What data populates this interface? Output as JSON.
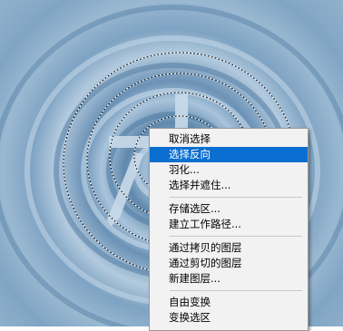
{
  "colors": {
    "canvas_bg": "#7fa3c1",
    "ripple_light": "#b8cfe2",
    "ripple_dark": "#4f7ea6",
    "menu_bg": "#f2f2f2",
    "highlight": "#0a6fd0"
  },
  "canvas": {
    "glyph": "大",
    "selection": "marching-ants"
  },
  "context_menu": {
    "groups": [
      [
        {
          "label": "取消选择"
        },
        {
          "label": "选择反向",
          "highlighted": true
        },
        {
          "label": "羽化..."
        },
        {
          "label": "选择并遮住..."
        }
      ],
      [
        {
          "label": "存储选区..."
        },
        {
          "label": "建立工作路径..."
        }
      ],
      [
        {
          "label": "通过拷贝的图层"
        },
        {
          "label": "通过剪切的图层"
        },
        {
          "label": "新建图层..."
        }
      ],
      [
        {
          "label": "自由变换"
        },
        {
          "label": "变换选区"
        }
      ]
    ]
  }
}
